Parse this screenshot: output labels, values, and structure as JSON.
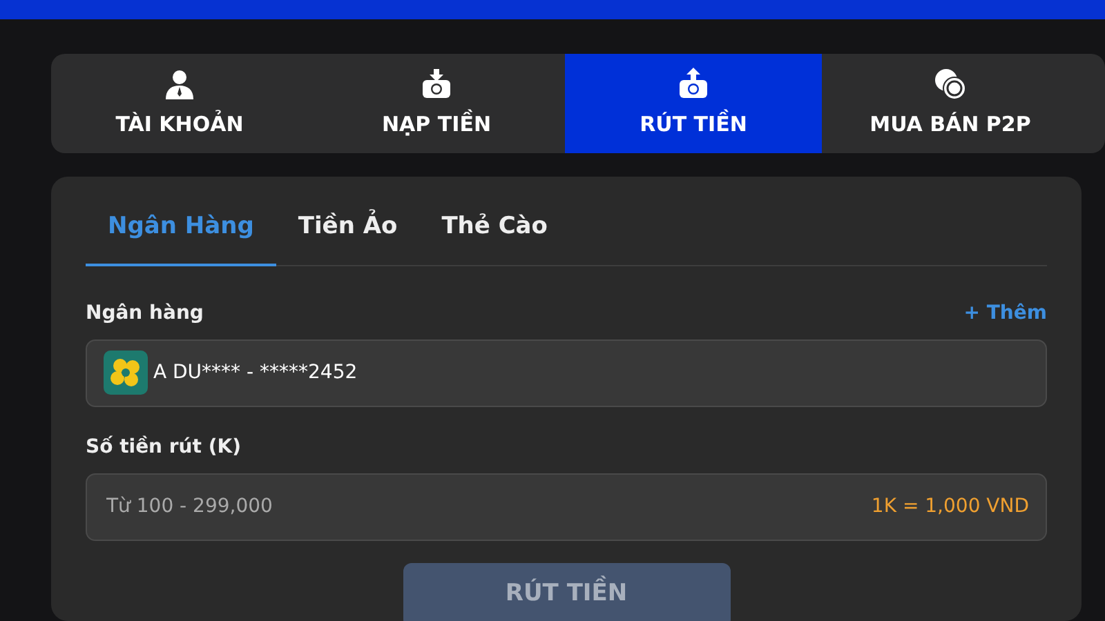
{
  "main_tabs": [
    {
      "label": "TÀI KHOẢN",
      "kind": "person",
      "selected": false
    },
    {
      "label": "NẠP TIỀN",
      "kind": "deposit",
      "selected": false
    },
    {
      "label": "RÚT TIỀN",
      "kind": "withdraw",
      "selected": true
    },
    {
      "label": "MUA BÁN P2P",
      "kind": "coins",
      "selected": false
    }
  ],
  "method_tabs": [
    {
      "label": "Ngân Hàng",
      "selected": true
    },
    {
      "label": "Tiền Ảo",
      "selected": false
    },
    {
      "label": "Thẻ Cào",
      "selected": false
    }
  ],
  "bank": {
    "label": "Ngân hàng",
    "add_link": "+ Thêm",
    "value": "A DU**** - *****2452"
  },
  "amount": {
    "label": "Số tiền rút (K)",
    "placeholder": "Từ 100 - 299,000",
    "rate": "1K = 1,000 VND"
  },
  "submit": {
    "label": "RÚT TIỀN",
    "disabled": true
  }
}
